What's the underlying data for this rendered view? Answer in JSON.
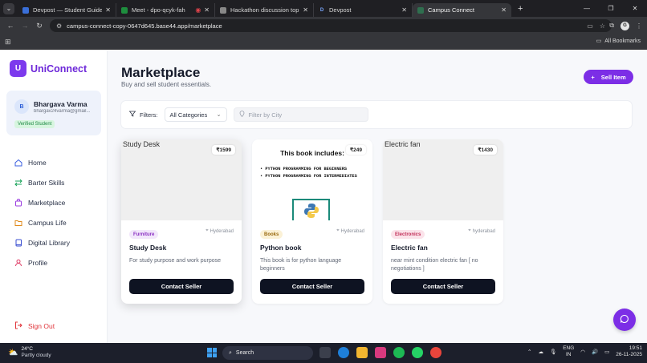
{
  "browser": {
    "tabs": [
      {
        "title": "Devpost — Student Guide for",
        "favicon": "devpost-icon",
        "color": "#3a6fd8",
        "active": false
      },
      {
        "title": "Meet - dpo-qcyk-fah",
        "favicon": "meet-icon",
        "color": "#1e8e3e",
        "active": false
      },
      {
        "title": "",
        "favicon": "record-icon",
        "color": "#e0434b",
        "active": false
      },
      {
        "title": "Hackathon discussion topics",
        "favicon": "web-icon",
        "color": "#888888",
        "active": false
      },
      {
        "title": "Devpost",
        "favicon": "devpost-d-icon",
        "color": "#1f1f23",
        "active": false
      },
      {
        "title": "Campus Connect",
        "favicon": "app-icon",
        "color": "#2f6f4f",
        "active": true
      }
    ],
    "url": "campus-connect-copy-0647d645.base44.app/marketplace",
    "all_bookmarks": "All Bookmarks",
    "profile_initial": "G"
  },
  "brand": {
    "logo_letter": "U",
    "name": "UniConnect",
    "accent": "#7c3aed"
  },
  "user": {
    "initial": "B",
    "name": "Bhargava Varma",
    "email": "bhargav24varma@gmail...",
    "badge": "Verified Student"
  },
  "nav": {
    "items": [
      {
        "label": "Home",
        "icon": "home-icon"
      },
      {
        "label": "Barter Skills",
        "icon": "swap-icon"
      },
      {
        "label": "Marketplace",
        "icon": "shopping-bag-icon"
      },
      {
        "label": "Campus Life",
        "icon": "folder-icon"
      },
      {
        "label": "Digital Library",
        "icon": "book-icon"
      },
      {
        "label": "Profile",
        "icon": "user-icon"
      }
    ],
    "signout": "Sign Out"
  },
  "page": {
    "title": "Marketplace",
    "subtitle": "Buy and sell student essentials.",
    "sell_button": "Sell Item"
  },
  "filters": {
    "label": "Filters:",
    "category_value": "All Categories",
    "city_placeholder": "Filter by City"
  },
  "listings": [
    {
      "image_alt": "Study Desk",
      "price": "₹1599",
      "category": "Furniture",
      "location": "Hyderabad",
      "title": "Study Desk",
      "description": "For study purpose and work purpose",
      "button": "Contact Seller"
    },
    {
      "image_alt": "",
      "price": "₹249",
      "category": "Books",
      "location": "Hyderabad",
      "title": "Python book",
      "description": "This book is for python language beginners",
      "button": "Contact Seller",
      "image_text": {
        "heading": "This book includes:",
        "line1": "• PYTHON PROGRAMMING FOR BEGINNERS",
        "line2": "• PYTHON PROGRAMMING FOR INTERMEDIATES"
      }
    },
    {
      "image_alt": "Electric fan",
      "price": "₹1430",
      "category": "Electronics",
      "location": "hyderabad",
      "title": "Electric fan",
      "description": "near mint condition electric fan [ no negotiations ]",
      "button": "Contact Seller"
    }
  ],
  "taskbar": {
    "temp": "24°C",
    "condition": "Partly cloudy",
    "search": "Search",
    "lang1": "ENG",
    "lang2": "IN",
    "time": "19:51",
    "date": "26-11-2025"
  }
}
